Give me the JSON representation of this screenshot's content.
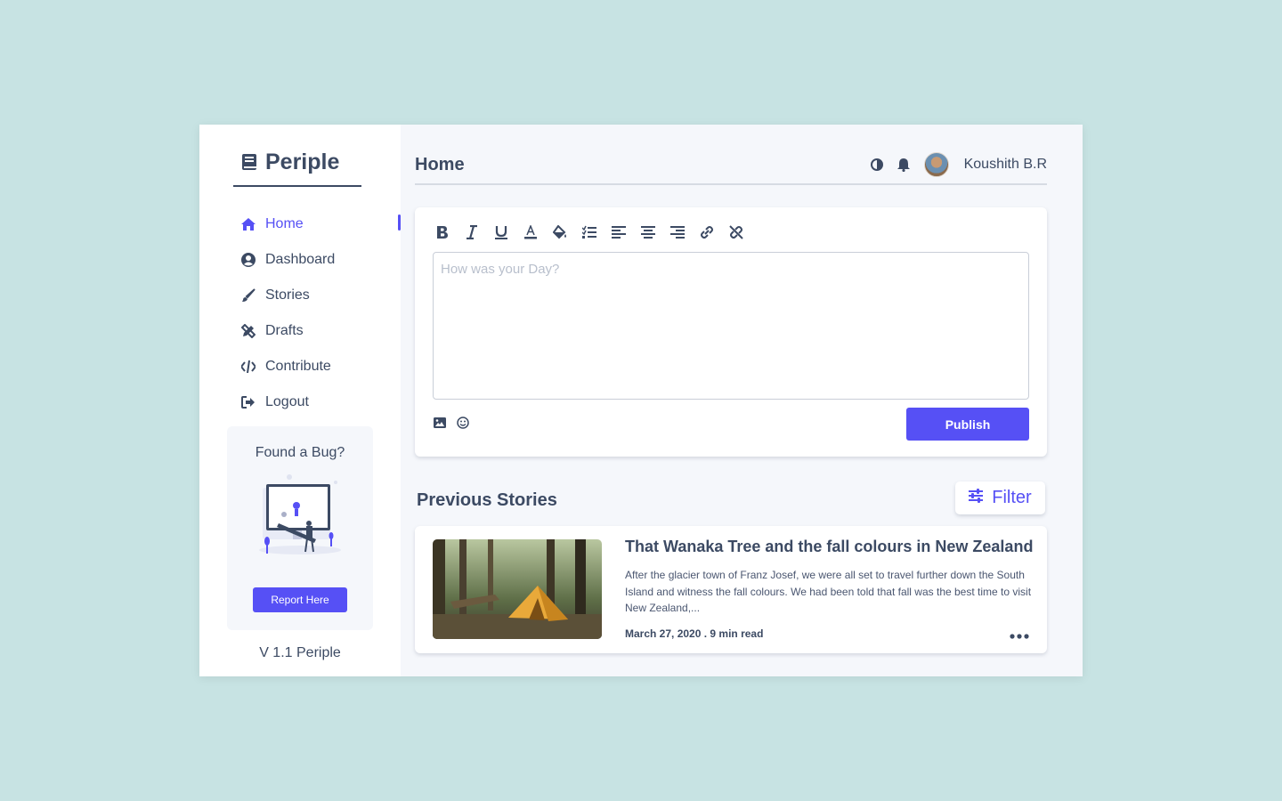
{
  "app": {
    "name": "Periple",
    "version_label": "V 1.1 Periple"
  },
  "sidebar": {
    "items": [
      {
        "label": "Home",
        "icon": "home-icon",
        "active": true
      },
      {
        "label": "Dashboard",
        "icon": "user-circle-icon",
        "active": false
      },
      {
        "label": "Stories",
        "icon": "brush-icon",
        "active": false
      },
      {
        "label": "Drafts",
        "icon": "pencil-ruler-icon",
        "active": false
      },
      {
        "label": "Contribute",
        "icon": "code-icon",
        "active": false
      },
      {
        "label": "Logout",
        "icon": "sign-out-icon",
        "active": false
      }
    ],
    "bug_card": {
      "title": "Found a Bug?",
      "button_label": "Report Here"
    }
  },
  "header": {
    "title": "Home",
    "user_name": "Koushith B.R",
    "icons": [
      "contrast-icon",
      "bell-icon"
    ]
  },
  "editor": {
    "toolbar": [
      "bold-icon",
      "italic-icon",
      "underline-icon",
      "text-color-icon",
      "fill-color-icon",
      "list-icon",
      "align-left-icon",
      "align-center-icon",
      "align-right-icon",
      "link-icon",
      "unlink-icon"
    ],
    "placeholder": "How was your Day?",
    "value": "",
    "publish_label": "Publish"
  },
  "stories": {
    "section_title": "Previous Stories",
    "filter_label": "Filter",
    "items": [
      {
        "title": "That Wanaka Tree and the fall colours in New Zealand",
        "excerpt": "After the glacier town of Franz Josef, we were all set to travel further down the South Island and witness the fall colours. We had been told that fall was the best time to visit New Zealand,...",
        "meta": "March 27, 2020 . 9 min read"
      }
    ]
  },
  "colors": {
    "accent": "#5650f5",
    "text": "#3c4a63",
    "page_bg": "#c7e3e3",
    "panel_bg": "#f5f7fb"
  }
}
